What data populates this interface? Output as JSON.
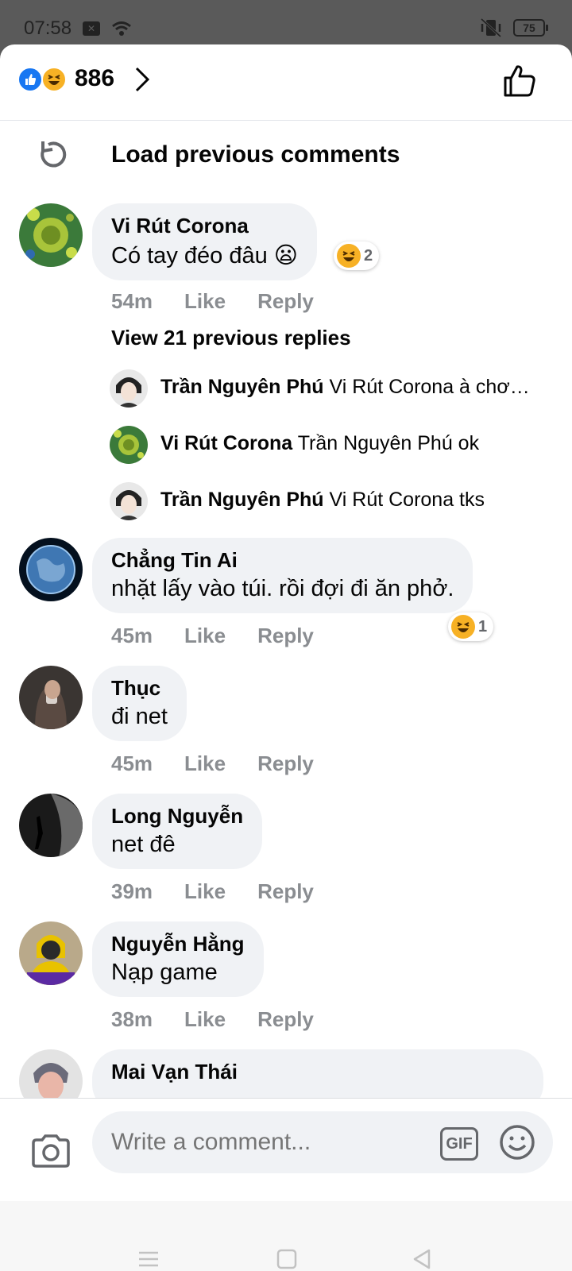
{
  "status_bar": {
    "time": "07:58",
    "battery": "75"
  },
  "reactions": {
    "count": "886"
  },
  "load_previous": "Load previous comments",
  "comments": [
    {
      "name": "Vi Rút Corona",
      "text": "Có tay đéo đâu 😦",
      "time": "54m",
      "like": "Like",
      "reply": "Reply",
      "reaction_count": "2"
    },
    {
      "name": "Chẳng Tin Ai",
      "text": "nhặt lấy vào túi. rồi đợi đi ăn phở.",
      "time": "45m",
      "like": "Like",
      "reply": "Reply",
      "reaction_count": "1"
    },
    {
      "name": "Thục",
      "text": "đi net",
      "time": "45m",
      "like": "Like",
      "reply": "Reply"
    },
    {
      "name": "Long Nguyễn",
      "text": "net đê",
      "time": "39m",
      "like": "Like",
      "reply": "Reply"
    },
    {
      "name": "Nguyễn Hằng",
      "text": "Nạp game",
      "time": "38m",
      "like": "Like",
      "reply": "Reply"
    },
    {
      "name": "Mai Vạn Thái"
    }
  ],
  "view_replies": "View 21 previous replies",
  "replies": [
    {
      "name": "Trần Nguyên Phú",
      "text": "Vi Rút Corona à chơi game đó hả"
    },
    {
      "name": "Vi Rút Corona",
      "text": "Trần Nguyên Phú ok"
    },
    {
      "name": "Trần Nguyên Phú",
      "text": "Vi Rút Corona tks"
    }
  ],
  "composer": {
    "placeholder": "Write a comment...",
    "gif": "GIF"
  },
  "colors": {
    "accent": "#1877f2",
    "bubble": "#f0f2f5",
    "meta": "#8a8d91",
    "haha": "#f7b125"
  }
}
